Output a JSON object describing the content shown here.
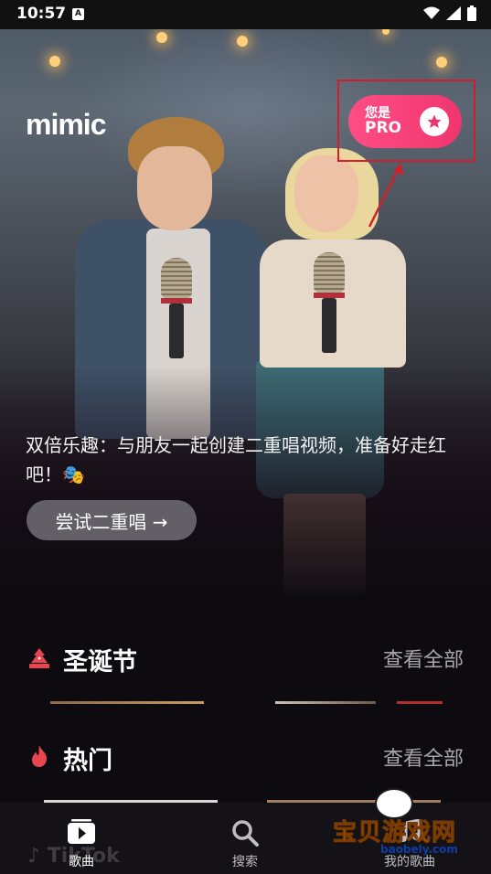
{
  "status_bar": {
    "time": "10:57",
    "notif_icon": "A"
  },
  "header": {
    "logo": "mimic"
  },
  "pro_badge": {
    "line1": "您是",
    "line2": "PRO",
    "icon": "star-icon",
    "color": "#f0356e"
  },
  "promo": {
    "text": "双倍乐趣：与朋友一起创建二重唱视频，准备好走红吧！🎭",
    "button_label": "尝试二重唱 →"
  },
  "sections": [
    {
      "title": "圣诞节",
      "icon": "christmas-tree-icon",
      "more": "查看全部"
    },
    {
      "title": "热门",
      "icon": "fire-icon",
      "more": "查看全部"
    }
  ],
  "nav": [
    {
      "label": "歌曲",
      "icon": "play-icon",
      "active": true
    },
    {
      "label": "搜索",
      "icon": "search-icon",
      "active": false
    },
    {
      "label": "我的歌曲",
      "icon": "music-icon",
      "active": false
    }
  ],
  "watermark": {
    "title": "宝贝游戏网",
    "url": "baobely.com"
  },
  "accent_color": "#e8464f"
}
